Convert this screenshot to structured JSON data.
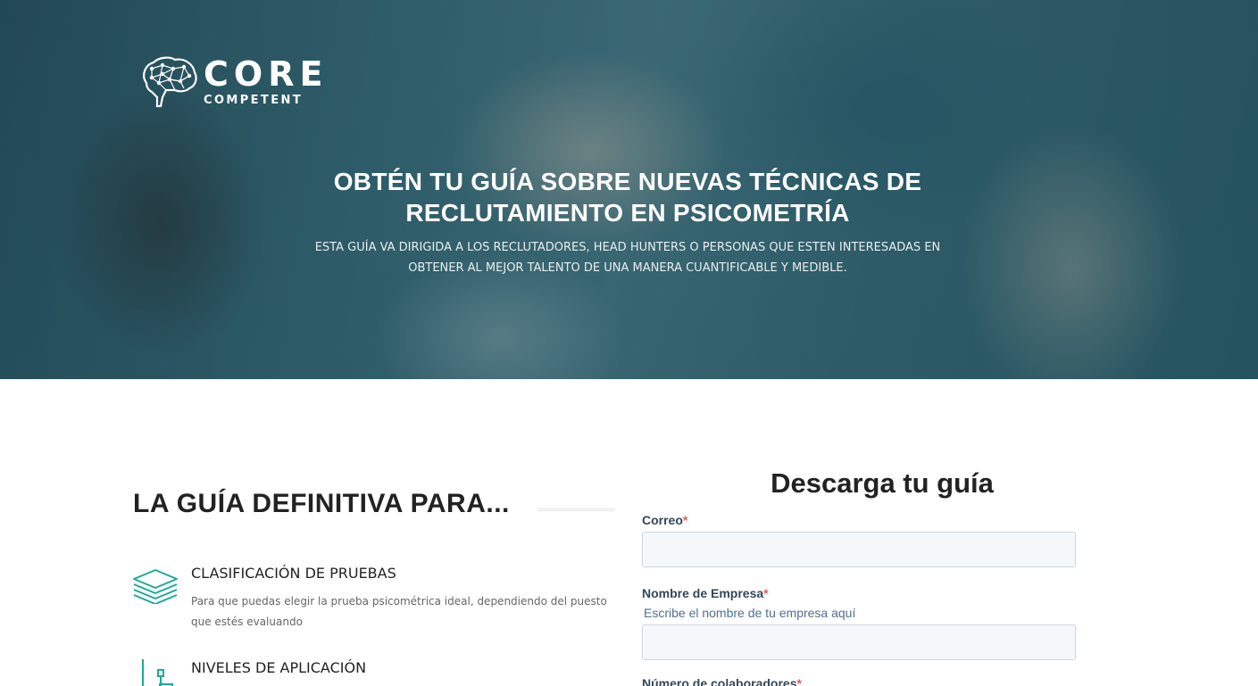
{
  "brand": {
    "word1": "CORE",
    "word2": "COMPETENT",
    "logo_icon": "brain-network-icon",
    "color": "#ffffff"
  },
  "hero": {
    "title": "OBTÉN TU GUÍA SOBRE NUEVAS TÉCNICAS DE RECLUTAMIENTO EN PSICOMETRÍA",
    "subtitle": "ESTA GUÍA VA DIRIGIDA A LOS RECLUTADORES, HEAD HUNTERS O PERSONAS QUE ESTEN INTERESADAS EN OBTENER AL MEJOR TALENTO DE UNA MANERA CUANTIFICABLE Y MEDIBLE."
  },
  "features_section": {
    "heading": "LA GUÍA DEFINITIVA PARA...",
    "accent_color": "#1aaa9a",
    "items": [
      {
        "icon": "layers-icon",
        "title": "CLASIFICACIÓN DE PRUEBAS",
        "description": "Para que puedas elegir la prueba psicométrica ideal, dependiendo del puesto que estés evaluando"
      },
      {
        "icon": "hierarchy-icon",
        "title": "NIVELES DE APLICACIÓN",
        "description": ""
      }
    ]
  },
  "form": {
    "title": "Descarga tu guía",
    "required_mark": "*",
    "fields": [
      {
        "label": "Correo",
        "hint": "",
        "value": ""
      },
      {
        "label": "Nombre de Empresa",
        "hint": "Escribe el nombre de tu empresa aquí",
        "value": ""
      },
      {
        "label": "Número de colaboradores",
        "hint": "",
        "value": ""
      }
    ]
  }
}
